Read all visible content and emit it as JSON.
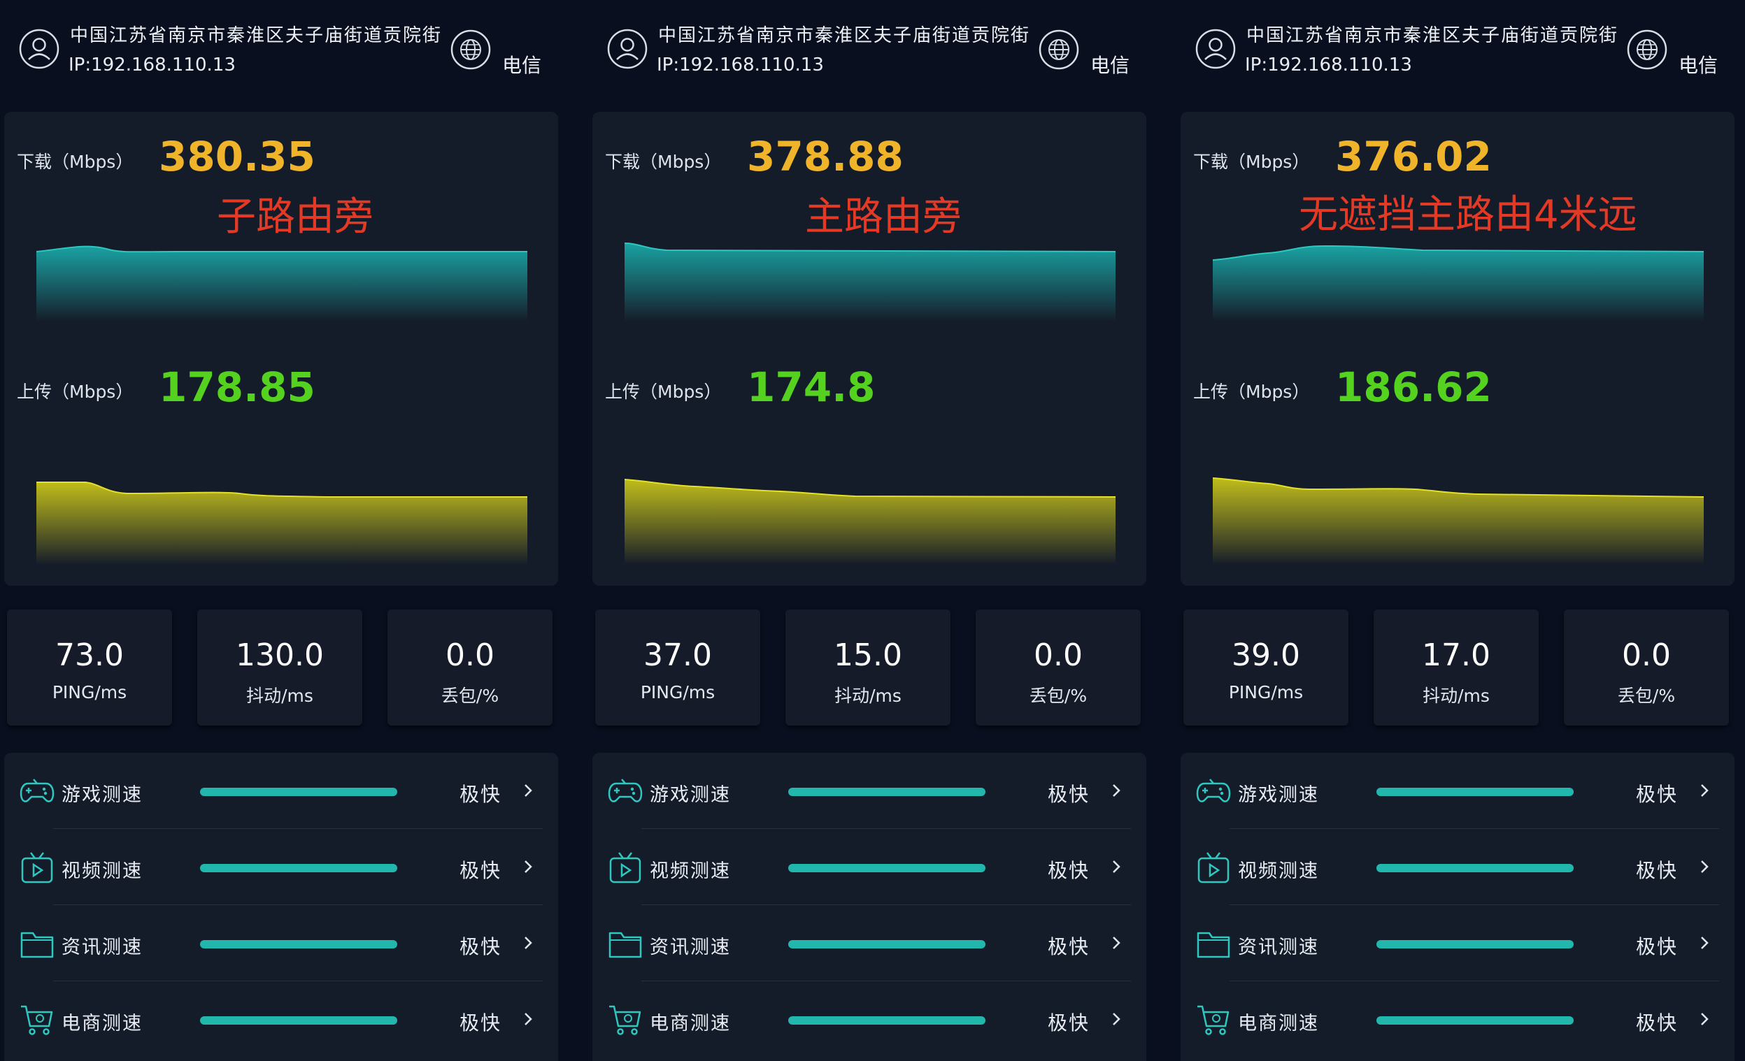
{
  "colors": {
    "background": "#0a0f1f",
    "card": "#151c29",
    "download_value": "#f0b42b",
    "upload_value": "#54d21f",
    "note": "#e43a25",
    "download_graph": "#1aa8a8",
    "upload_graph": "#c9c51a",
    "test_bar": "#21b7ad"
  },
  "panels": [
    {
      "location": "中国江苏省南京市秦淮区夫子庙街道贡院街",
      "ip": "IP:192.168.110.13",
      "isp": "电信",
      "download_label": "下载（Mbps）",
      "download_value": "380.35",
      "note": "子路由旁",
      "upload_label": "上传（Mbps）",
      "upload_value": "178.85",
      "stats": [
        {
          "value": "73.0",
          "label": "PING/ms"
        },
        {
          "value": "130.0",
          "label": "抖动/ms"
        },
        {
          "value": "0.0",
          "label": "丢包/%"
        }
      ],
      "tests": [
        {
          "icon": "gamepad-icon",
          "name": "游戏测速",
          "rating": "极快",
          "progress": 1.0
        },
        {
          "icon": "video-icon",
          "name": "视频测速",
          "rating": "极快",
          "progress": 1.0
        },
        {
          "icon": "folder-icon",
          "name": "资讯测速",
          "rating": "极快",
          "progress": 1.0
        },
        {
          "icon": "cart-icon",
          "name": "电商测速",
          "rating": "极快",
          "progress": 1.0
        }
      ]
    },
    {
      "location": "中国江苏省南京市秦淮区夫子庙街道贡院街",
      "ip": "IP:192.168.110.13",
      "isp": "电信",
      "download_label": "下载（Mbps）",
      "download_value": "378.88",
      "note": "主路由旁",
      "upload_label": "上传（Mbps）",
      "upload_value": "174.8",
      "stats": [
        {
          "value": "37.0",
          "label": "PING/ms"
        },
        {
          "value": "15.0",
          "label": "抖动/ms"
        },
        {
          "value": "0.0",
          "label": "丢包/%"
        }
      ],
      "tests": [
        {
          "icon": "gamepad-icon",
          "name": "游戏测速",
          "rating": "极快",
          "progress": 1.0
        },
        {
          "icon": "video-icon",
          "name": "视频测速",
          "rating": "极快",
          "progress": 1.0
        },
        {
          "icon": "folder-icon",
          "name": "资讯测速",
          "rating": "极快",
          "progress": 1.0
        },
        {
          "icon": "cart-icon",
          "name": "电商测速",
          "rating": "极快",
          "progress": 1.0
        }
      ]
    },
    {
      "location": "中国江苏省南京市秦淮区夫子庙街道贡院街",
      "ip": "IP:192.168.110.13",
      "isp": "电信",
      "download_label": "下载（Mbps）",
      "download_value": "376.02",
      "note": "无遮挡主路由4米远",
      "upload_label": "上传（Mbps）",
      "upload_value": "186.62",
      "stats": [
        {
          "value": "39.0",
          "label": "PING/ms"
        },
        {
          "value": "17.0",
          "label": "抖动/ms"
        },
        {
          "value": "0.0",
          "label": "丢包/%"
        }
      ],
      "tests": [
        {
          "icon": "gamepad-icon",
          "name": "游戏测速",
          "rating": "极快",
          "progress": 1.0
        },
        {
          "icon": "video-icon",
          "name": "视频测速",
          "rating": "极快",
          "progress": 1.0
        },
        {
          "icon": "folder-icon",
          "name": "资讯测速",
          "rating": "极快",
          "progress": 1.0
        },
        {
          "icon": "cart-icon",
          "name": "电商测速",
          "rating": "极快",
          "progress": 1.0
        }
      ]
    }
  ]
}
